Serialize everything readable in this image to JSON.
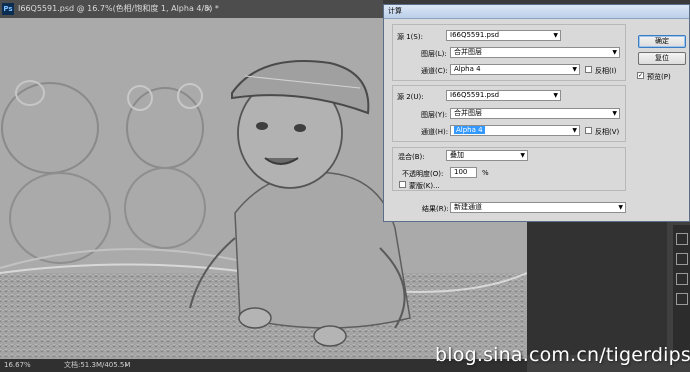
{
  "app": {
    "icon_text": "Ps"
  },
  "document_tab": {
    "title": "I66Q5591.psd @ 16.7%(色相/饱和度 1, Alpha 4/8) *",
    "close_glyph": "×"
  },
  "status_bar": {
    "zoom": "16.67%",
    "doc_info": "文档:51.3M/405.5M",
    "arrow": "▸"
  },
  "watermark": "blog.sina.com.cn/tigerdips",
  "dialog": {
    "title": "计算",
    "source1": {
      "label": "源 1(S):",
      "file": "I66Q5591.psd",
      "layer_label": "图层(L):",
      "layer": "合并图层",
      "channel_label": "通道(C):",
      "channel": "Alpha 4",
      "invert_label": "反相(I)",
      "invert_checked": false
    },
    "source2": {
      "label": "源 2(U):",
      "file": "I66Q5591.psd",
      "layer_label": "图层(Y):",
      "layer": "合并图层",
      "channel_label": "通道(H):",
      "channel": "Alpha 4",
      "invert_label": "反相(V)",
      "invert_checked": false
    },
    "blending": {
      "label": "混合(B):",
      "mode": "叠加",
      "opacity_label": "不透明度(O):",
      "opacity": "100",
      "opacity_unit": "%",
      "mask_label": "蒙版(K)...",
      "mask_checked": false
    },
    "result": {
      "label": "结果(R):",
      "value": "新建通道"
    },
    "buttons": {
      "ok": "确定",
      "reset": "复位"
    },
    "preview": {
      "label": "预览(P)",
      "checked": true
    }
  }
}
